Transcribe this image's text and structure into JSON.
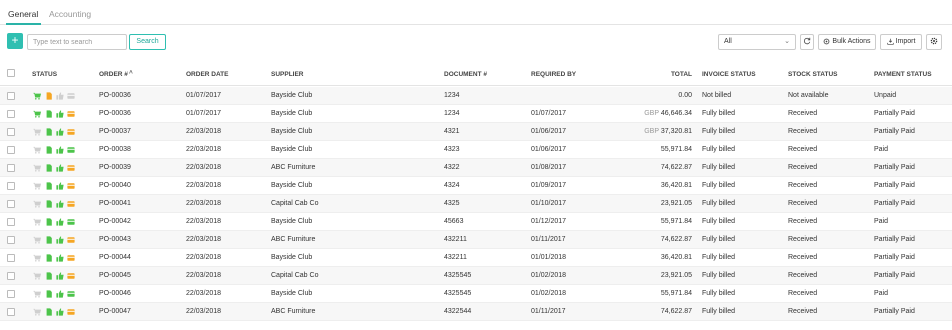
{
  "tabs": [
    {
      "label": "General",
      "active": true
    },
    {
      "label": "Accounting",
      "active": false
    }
  ],
  "toolbar": {
    "add_label": "+",
    "search_placeholder": "Type text to search",
    "search_label": "Search",
    "filter_value": "All",
    "bulk_actions_label": "Bulk Actions",
    "import_label": "Import"
  },
  "columns": {
    "status": "STATUS",
    "order": "ORDER #",
    "order_date": "ORDER DATE",
    "supplier": "SUPPLIER",
    "document": "DOCUMENT #",
    "required_by": "REQUIRED BY",
    "total": "TOTAL",
    "invoice_status": "INVOICE STATUS",
    "stock_status": "STOCK STATUS",
    "payment_status": "PAYMENT STATUS"
  },
  "colors": {
    "accent": "#2fbfb1",
    "green": "#4cc44a",
    "orange": "#f5a623",
    "grey": "#cfcfcf"
  },
  "rows": [
    {
      "status": [
        "green",
        "orange",
        "grey",
        "grey"
      ],
      "order": "PO-00036",
      "order_date": "01/07/2017",
      "supplier": "Bayside Club",
      "document": "1234",
      "required_by": "",
      "currency": "",
      "total": "0.00",
      "invoice": "Not billed",
      "stock": "Not available",
      "payment": "Unpaid"
    },
    {
      "status": [
        "green",
        "green",
        "green",
        "orange"
      ],
      "order": "PO-00036",
      "order_date": "01/07/2017",
      "supplier": "Bayside Club",
      "document": "1234",
      "required_by": "01/07/2017",
      "currency": "GBP",
      "total": "46,646.34",
      "invoice": "Fully billed",
      "stock": "Received",
      "payment": "Partially Paid"
    },
    {
      "status": [
        "grey",
        "green",
        "green",
        "orange"
      ],
      "order": "PO-00037",
      "order_date": "22/03/2018",
      "supplier": "Bayside Club",
      "document": "4321",
      "required_by": "01/06/2017",
      "currency": "GBP",
      "total": "37,320.81",
      "invoice": "Fully billed",
      "stock": "Received",
      "payment": "Partially Paid"
    },
    {
      "status": [
        "grey",
        "green",
        "green",
        "green"
      ],
      "order": "PO-00038",
      "order_date": "22/03/2018",
      "supplier": "Bayside Club",
      "document": "4323",
      "required_by": "01/06/2017",
      "currency": "",
      "total": "55,971.84",
      "invoice": "Fully billed",
      "stock": "Received",
      "payment": "Paid"
    },
    {
      "status": [
        "grey",
        "green",
        "green",
        "orange"
      ],
      "order": "PO-00039",
      "order_date": "22/03/2018",
      "supplier": "ABC Furniture",
      "document": "4322",
      "required_by": "01/08/2017",
      "currency": "",
      "total": "74,622.87",
      "invoice": "Fully billed",
      "stock": "Received",
      "payment": "Partially Paid"
    },
    {
      "status": [
        "grey",
        "green",
        "green",
        "orange"
      ],
      "order": "PO-00040",
      "order_date": "22/03/2018",
      "supplier": "Bayside Club",
      "document": "4324",
      "required_by": "01/09/2017",
      "currency": "",
      "total": "36,420.81",
      "invoice": "Fully billed",
      "stock": "Received",
      "payment": "Partially Paid"
    },
    {
      "status": [
        "grey",
        "green",
        "green",
        "orange"
      ],
      "order": "PO-00041",
      "order_date": "22/03/2018",
      "supplier": "Capital Cab Co",
      "document": "4325",
      "required_by": "01/10/2017",
      "currency": "",
      "total": "23,921.05",
      "invoice": "Fully billed",
      "stock": "Received",
      "payment": "Partially Paid"
    },
    {
      "status": [
        "grey",
        "green",
        "green",
        "green"
      ],
      "order": "PO-00042",
      "order_date": "22/03/2018",
      "supplier": "Bayside Club",
      "document": "45663",
      "required_by": "01/12/2017",
      "currency": "",
      "total": "55,971.84",
      "invoice": "Fully billed",
      "stock": "Received",
      "payment": "Paid"
    },
    {
      "status": [
        "grey",
        "green",
        "green",
        "orange"
      ],
      "order": "PO-00043",
      "order_date": "22/03/2018",
      "supplier": "ABC Furniture",
      "document": "432211",
      "required_by": "01/11/2017",
      "currency": "",
      "total": "74,622.87",
      "invoice": "Fully billed",
      "stock": "Received",
      "payment": "Partially Paid"
    },
    {
      "status": [
        "grey",
        "green",
        "green",
        "orange"
      ],
      "order": "PO-00044",
      "order_date": "22/03/2018",
      "supplier": "Bayside Club",
      "document": "432211",
      "required_by": "01/01/2018",
      "currency": "",
      "total": "36,420.81",
      "invoice": "Fully billed",
      "stock": "Received",
      "payment": "Partially Paid"
    },
    {
      "status": [
        "grey",
        "green",
        "green",
        "orange"
      ],
      "order": "PO-00045",
      "order_date": "22/03/2018",
      "supplier": "Capital Cab Co",
      "document": "4325545",
      "required_by": "01/02/2018",
      "currency": "",
      "total": "23,921.05",
      "invoice": "Fully billed",
      "stock": "Received",
      "payment": "Partially Paid"
    },
    {
      "status": [
        "grey",
        "green",
        "green",
        "green"
      ],
      "order": "PO-00046",
      "order_date": "22/03/2018",
      "supplier": "Bayside Club",
      "document": "4325545",
      "required_by": "01/02/2018",
      "currency": "",
      "total": "55,971.84",
      "invoice": "Fully billed",
      "stock": "Received",
      "payment": "Paid"
    },
    {
      "status": [
        "grey",
        "green",
        "green",
        "orange"
      ],
      "order": "PO-00047",
      "order_date": "22/03/2018",
      "supplier": "ABC Furniture",
      "document": "4322544",
      "required_by": "01/11/2017",
      "currency": "",
      "total": "74,622.87",
      "invoice": "Fully billed",
      "stock": "Received",
      "payment": "Partially Paid"
    }
  ]
}
